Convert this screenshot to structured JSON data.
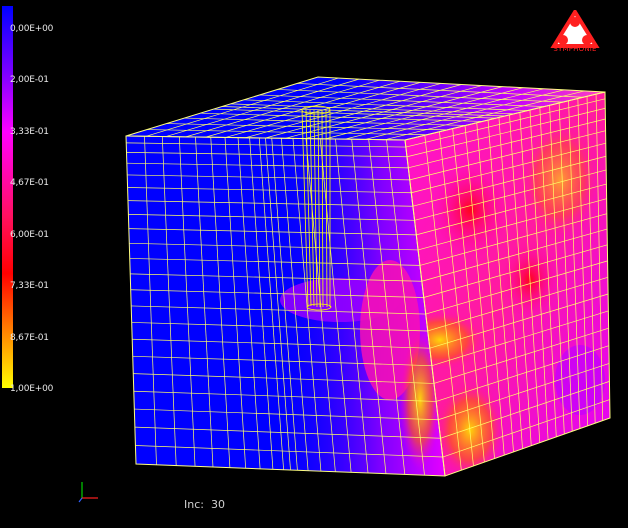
{
  "app": {
    "name": "SYMPHONIE"
  },
  "legend": {
    "ticks": [
      "0,00E+00",
      "2,00E-01",
      "3,33E-01",
      "4,67E-01",
      "6,00E-01",
      "7,33E-01",
      "8,67E-01",
      "1,00E+00"
    ],
    "colors": [
      "#0000ff",
      "#b000ff",
      "#ff00ff",
      "#ff1080",
      "#ff0000",
      "#ff5000",
      "#ff9000",
      "#ffff00"
    ]
  },
  "status": {
    "increment_label": "Inc:",
    "increment_value": "30"
  },
  "icons": {
    "axis_triad": "xyz-axes-icon",
    "logo": "symphonie-logo-icon"
  }
}
